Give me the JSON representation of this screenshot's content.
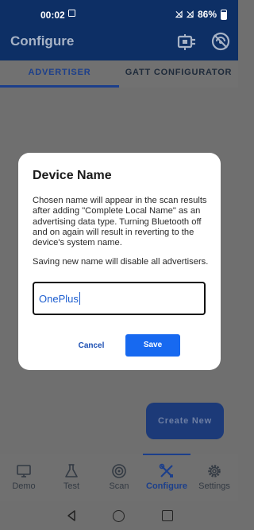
{
  "status_bar": {
    "time": "00:02",
    "battery": "86%",
    "icons": [
      "image-icon",
      "no-signal-icon",
      "no-signal-icon",
      "battery-icon"
    ]
  },
  "app_bar": {
    "title": "Configure",
    "icons": [
      "adapter-icon",
      "bluetooth-off-icon"
    ]
  },
  "tabs": [
    {
      "label": "ADVERTISER",
      "active": true
    },
    {
      "label": "GATT CONFIGURATOR",
      "active": false
    }
  ],
  "fab": {
    "label": "Create New"
  },
  "bottom_nav": [
    {
      "label": "Demo",
      "icon": "monitor-icon",
      "active": false
    },
    {
      "label": "Test",
      "icon": "flask-icon",
      "active": false
    },
    {
      "label": "Scan",
      "icon": "radar-icon",
      "active": false
    },
    {
      "label": "Configure",
      "icon": "tools-icon",
      "active": true
    },
    {
      "label": "Settings",
      "icon": "gear-icon",
      "active": false
    }
  ],
  "dialog": {
    "title": "Device Name",
    "paragraph_1": "Chosen name will appear in the scan results after adding \"Complete Local Name\" as an advertising data type. Turning Bluetooth off and on again will result in reverting to the device's system name.",
    "paragraph_2": "Saving new name will disable all advertisers.",
    "input_value": "OnePlus",
    "cancel_label": "Cancel",
    "save_label": "Save"
  },
  "colors": {
    "primary": "#1769f0",
    "app_bar": "#0d2f65",
    "scrim": "#6f6f6f"
  }
}
